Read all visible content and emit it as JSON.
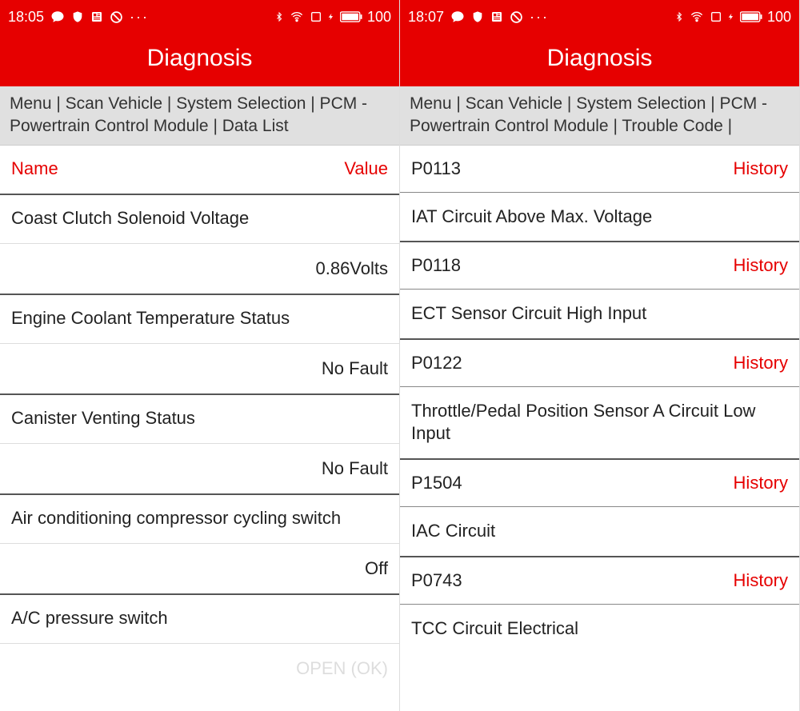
{
  "left": {
    "status": {
      "time": "18:05",
      "battery": "100"
    },
    "title": "Diagnosis",
    "breadcrumb": "Menu | Scan Vehicle | System Selection | PCM - Powertrain Control Module | Data List",
    "header": {
      "name": "Name",
      "value": "Value"
    },
    "items": [
      {
        "name": "Coast Clutch Solenoid Voltage",
        "value": "0.86Volts"
      },
      {
        "name": "Engine Coolant Temperature Status",
        "value": "No Fault"
      },
      {
        "name": "Canister Venting Status",
        "value": "No Fault"
      },
      {
        "name": "Air conditioning compressor cycling switch",
        "value": "Off"
      },
      {
        "name": "A/C pressure switch",
        "value": "OPEN (OK)"
      }
    ]
  },
  "right": {
    "status": {
      "time": "18:07",
      "battery": "100"
    },
    "title": "Diagnosis",
    "breadcrumb": "Menu | Scan Vehicle | System Selection | PCM - Powertrain Control Module | Trouble Code |",
    "codes": [
      {
        "code": "P0113",
        "status": "History",
        "desc": "IAT Circuit Above Max. Voltage"
      },
      {
        "code": "P0118",
        "status": "History",
        "desc": "ECT Sensor Circuit High Input"
      },
      {
        "code": "P0122",
        "status": "History",
        "desc": "Throttle/Pedal Position Sensor A Circuit Low Input"
      },
      {
        "code": "P1504",
        "status": "History",
        "desc": "IAC Circuit"
      },
      {
        "code": "P0743",
        "status": "History",
        "desc": "TCC Circuit Electrical"
      }
    ]
  }
}
